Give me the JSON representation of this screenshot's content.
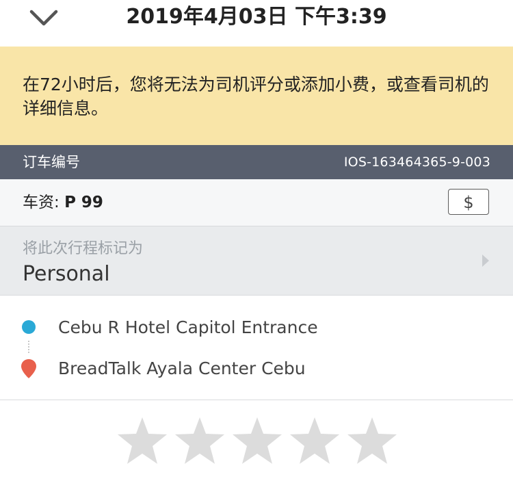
{
  "header": {
    "title": "2019年4月03日 下午3:39"
  },
  "notice": {
    "text": "在72小时后，您将无法为司机评分或添加小费，或查看司机的详细信息。"
  },
  "booking": {
    "label": "订车编号",
    "code": "IOS-163464365-9-003"
  },
  "fare": {
    "label": "车资: ",
    "amount": "P 99",
    "tip_symbol": "$"
  },
  "trip_mark": {
    "label": "将此次行程标记为",
    "value": "Personal"
  },
  "route": {
    "pickup": "Cebu R Hotel Capitol Entrance",
    "dropoff": "BreadTalk Ayala Center Cebu"
  },
  "rating": {
    "max_stars": 5,
    "current": 0
  },
  "colors": {
    "notice_bg": "#f9e5a8",
    "bar_bg": "#585f6e",
    "pickup": "#2aa9d6",
    "dropoff": "#e8604c",
    "star_empty": "#dcdcdc"
  }
}
